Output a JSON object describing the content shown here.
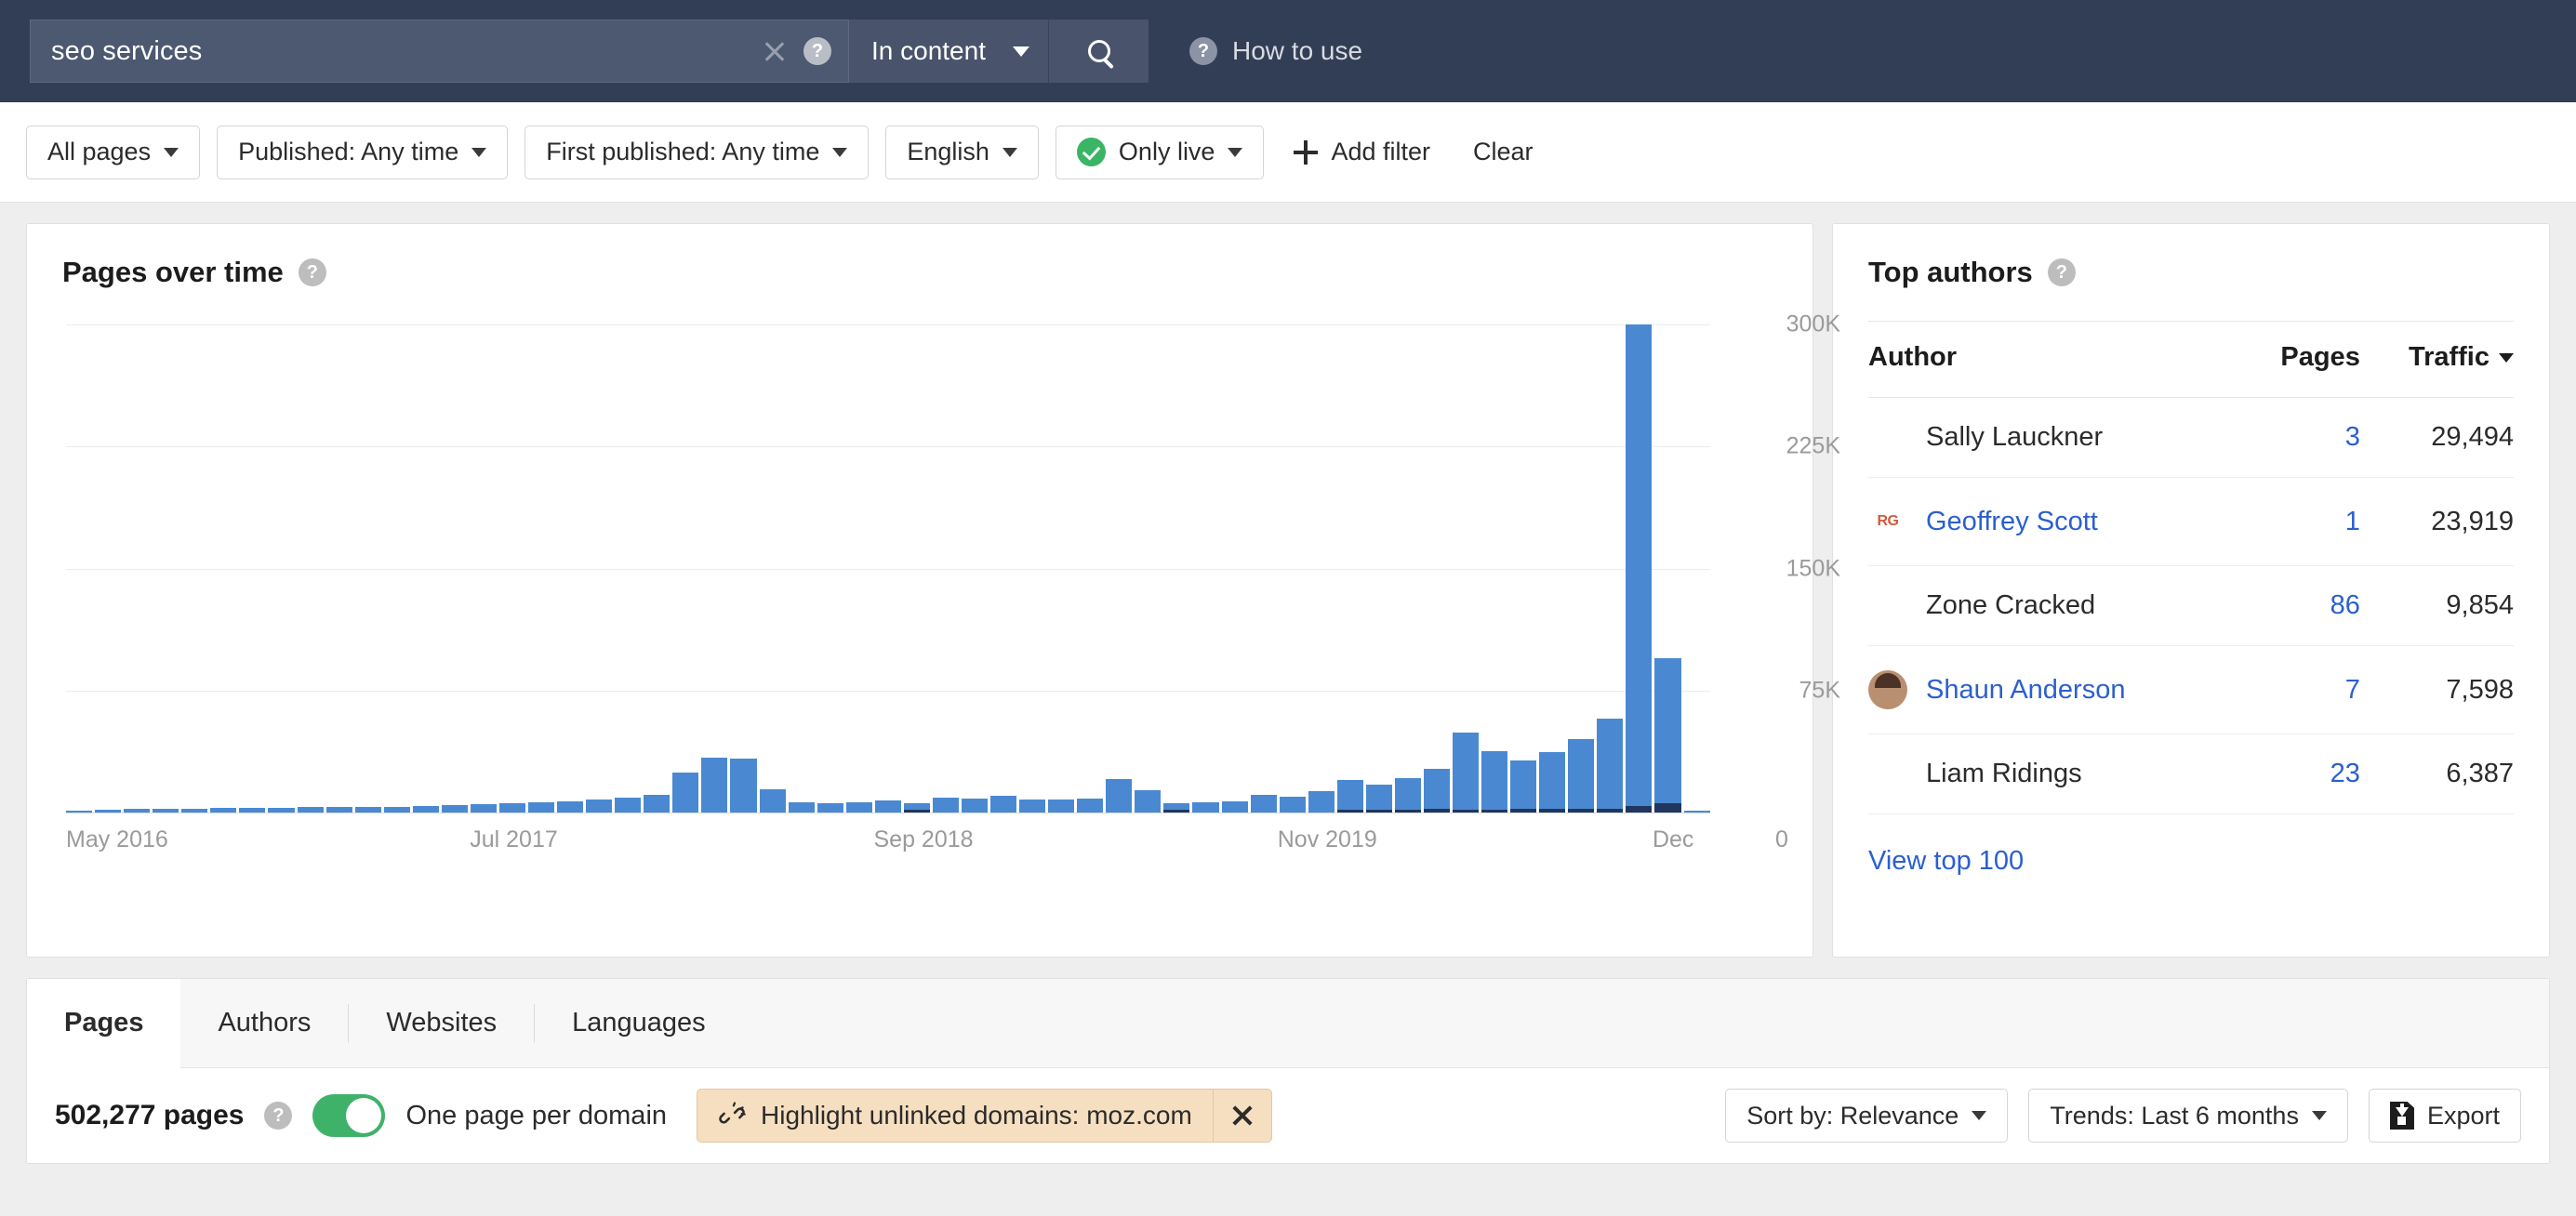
{
  "search": {
    "query": "seo services",
    "clear_icon": "close-icon",
    "help_icon": "question-mark-icon",
    "scope": "In content",
    "search_icon": "magnifier-icon",
    "how_to_use": "How to use",
    "how_to_use_icon": "question-mark-icon"
  },
  "filters": {
    "items": [
      {
        "label": "All pages",
        "has_caret": true,
        "has_check": false
      },
      {
        "label": "Published: Any time",
        "has_caret": true,
        "has_check": false
      },
      {
        "label": "First published: Any time",
        "has_caret": true,
        "has_check": false
      },
      {
        "label": "English",
        "has_caret": true,
        "has_check": false
      },
      {
        "label": "Only live",
        "has_caret": true,
        "has_check": true
      }
    ],
    "add_filter": "Add filter",
    "add_filter_icon": "plus-icon",
    "clear": "Clear"
  },
  "chart_card": {
    "title": "Pages over time",
    "help_icon": "question-mark-icon"
  },
  "chart_data": {
    "type": "bar",
    "title": "Pages over time",
    "xlabel": "",
    "ylabel": "",
    "ylim": [
      0,
      300000
    ],
    "yticks": [
      0,
      75000,
      150000,
      225000,
      300000
    ],
    "ytick_labels": [
      "0",
      "75K",
      "150K",
      "225K",
      "300K"
    ],
    "xtick_labels": [
      "May 2016",
      "Jul 2017",
      "Sep 2018",
      "Nov 2019",
      "Dec"
    ],
    "xtick_positions": [
      0,
      14,
      28,
      42,
      55
    ],
    "grid": true,
    "legend": false,
    "bar_color": "#4a89d2",
    "overlay_color": "#21365e",
    "series": [
      {
        "name": "Pages",
        "values": [
          900,
          1800,
          2200,
          2400,
          2500,
          2700,
          2900,
          3100,
          3200,
          3400,
          3500,
          3700,
          3900,
          4800,
          5200,
          5600,
          6200,
          6800,
          7800,
          9000,
          11000,
          24500,
          34000,
          33000,
          14500,
          6200,
          5600,
          6400,
          7200,
          6000,
          9000,
          8800,
          10500,
          7800,
          8200,
          8700,
          20500,
          14000,
          5500,
          6200,
          7000,
          11000,
          9500,
          13000,
          20000,
          17000,
          21000,
          27000,
          49000,
          38000,
          32000,
          37000,
          45000,
          58000,
          300000,
          95000,
          1200
        ]
      },
      {
        "name": "Unlinked",
        "values": [
          0,
          0,
          0,
          0,
          0,
          0,
          0,
          0,
          0,
          0,
          0,
          0,
          0,
          0,
          0,
          0,
          0,
          0,
          0,
          0,
          0,
          0,
          0,
          0,
          0,
          0,
          0,
          0,
          0,
          1200,
          0,
          0,
          0,
          0,
          0,
          0,
          0,
          0,
          1200,
          0,
          0,
          0,
          0,
          0,
          1500,
          2000,
          1500,
          2500,
          2000,
          2000,
          2200,
          2400,
          2500,
          2500,
          4000,
          6000,
          0
        ]
      }
    ]
  },
  "authors": {
    "title": "Top authors",
    "help_icon": "question-mark-icon",
    "columns": [
      "Author",
      "Pages",
      "Traffic"
    ],
    "sorted_by": "Traffic",
    "sort_caret_icon": "caret-down-icon",
    "rows": [
      {
        "name": "Sally Lauckner",
        "pages": "3",
        "traffic": "29,494",
        "avatar": "none",
        "is_link": false
      },
      {
        "name": "Geoffrey Scott",
        "pages": "1",
        "traffic": "23,919",
        "avatar": "rg-logo-icon",
        "is_link": true
      },
      {
        "name": "Zone Cracked",
        "pages": "86",
        "traffic": "9,854",
        "avatar": "none",
        "is_link": false
      },
      {
        "name": "Shaun Anderson",
        "pages": "7",
        "traffic": "7,598",
        "avatar": "photo-avatar",
        "is_link": true
      },
      {
        "name": "Liam Ridings",
        "pages": "23",
        "traffic": "6,387",
        "avatar": "none",
        "is_link": false
      }
    ],
    "view_top": "View top 100"
  },
  "bottom": {
    "tabs": [
      {
        "label": "Pages",
        "active": true
      },
      {
        "label": "Authors",
        "active": false
      },
      {
        "label": "Websites",
        "active": false
      },
      {
        "label": "Languages",
        "active": false
      }
    ],
    "page_count": "502,277 pages",
    "page_count_help_icon": "question-mark-icon",
    "toggle_label": "One page per domain",
    "toggle_on": true,
    "highlight_chip": {
      "icon": "broken-link-icon",
      "label": "Highlight unlinked domains: moz.com",
      "close_icon": "close-icon"
    },
    "sort_by": "Sort by: Relevance",
    "trends": "Trends: Last 6 months",
    "export": "Export",
    "export_icon": "download-file-icon"
  },
  "colors": {
    "header_bg": "#323e55",
    "bar_blue": "#4a89d2",
    "link_blue": "#2b5fd0",
    "toggle_green": "#3fb26a",
    "chip_bg": "#f6dfc0"
  }
}
